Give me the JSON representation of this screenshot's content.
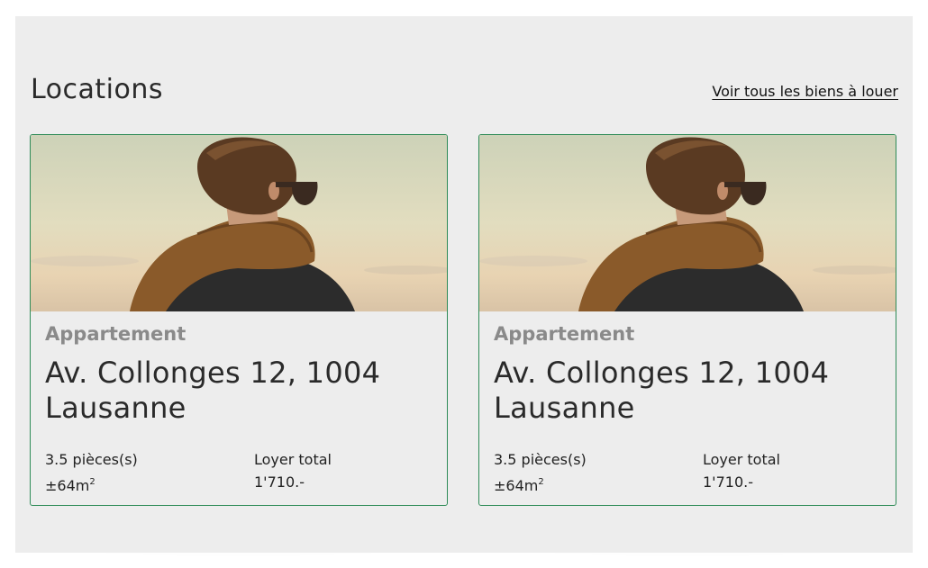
{
  "section": {
    "title": "Locations",
    "see_all": "Voir tous les biens à louer"
  },
  "cards": [
    {
      "type": "Appartement",
      "address": "Av. Collonges 12, 1004 Lausanne",
      "rooms": "3.5 pièces(s)",
      "area": "±64m",
      "area_sup": "2",
      "rent_label": "Loyer total",
      "rent_value": "1'710.-"
    },
    {
      "type": "Appartement",
      "address": "Av. Collonges 12, 1004 Lausanne",
      "rooms": "3.5 pièces(s)",
      "area": "±64m",
      "area_sup": "2",
      "rent_label": "Loyer total",
      "rent_value": "1'710.-"
    }
  ],
  "colors": {
    "panel_bg": "#ededed",
    "card_border": "#2e8b57",
    "type_text": "#8a8a8a"
  }
}
